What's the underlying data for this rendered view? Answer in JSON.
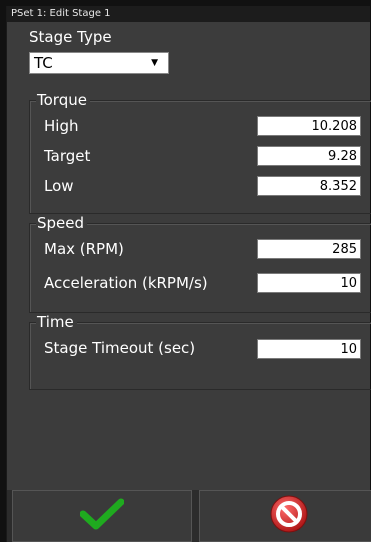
{
  "window": {
    "title": "PSet 1: Edit Stage 1"
  },
  "stage_type": {
    "label": "Stage Type",
    "selected": "TC"
  },
  "torque": {
    "title": "Torque",
    "rows": [
      {
        "label": "High",
        "value": "10.208"
      },
      {
        "label": "Target",
        "value": "9.28"
      },
      {
        "label": "Low",
        "value": "8.352"
      }
    ]
  },
  "speed": {
    "title": "Speed",
    "rows": [
      {
        "label": "Max (RPM)",
        "value": "285"
      },
      {
        "label": "Acceleration (kRPM/s)",
        "value": "10"
      }
    ]
  },
  "time": {
    "title": "Time",
    "rows": [
      {
        "label": "Stage Timeout (sec)",
        "value": "10"
      }
    ]
  },
  "buttons": {
    "ok_icon": "checkmark-icon",
    "cancel_icon": "no-entry-icon"
  },
  "colors": {
    "background": "#3c3c3c",
    "ok_green": "#1faa1f",
    "cancel_red": "#d22828"
  }
}
